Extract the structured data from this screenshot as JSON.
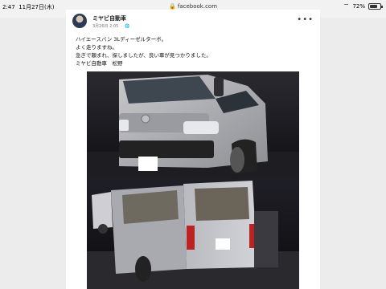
{
  "status_bar": {
    "time": "2:47",
    "date": "11月27日(木)",
    "url": "facebook.com",
    "battery": "72%",
    "battery_level": 0.72
  },
  "post": {
    "author": "ミヤビ自動車",
    "timestamp": "3月26日 2:05",
    "privacy_icon": "globe-icon",
    "more_icon": "more-options-icon",
    "lines": [
      "ハイエースバン 3Lディーゼルターボ。",
      "よく走りますね。",
      "急ぎで頼まれ、探しましたが、良い車が見つかりました。",
      "ミヤビ自動車　松野"
    ]
  },
  "photos": [
    {
      "subject": "silver-van-front"
    },
    {
      "subject": "silver-van-rear"
    }
  ]
}
